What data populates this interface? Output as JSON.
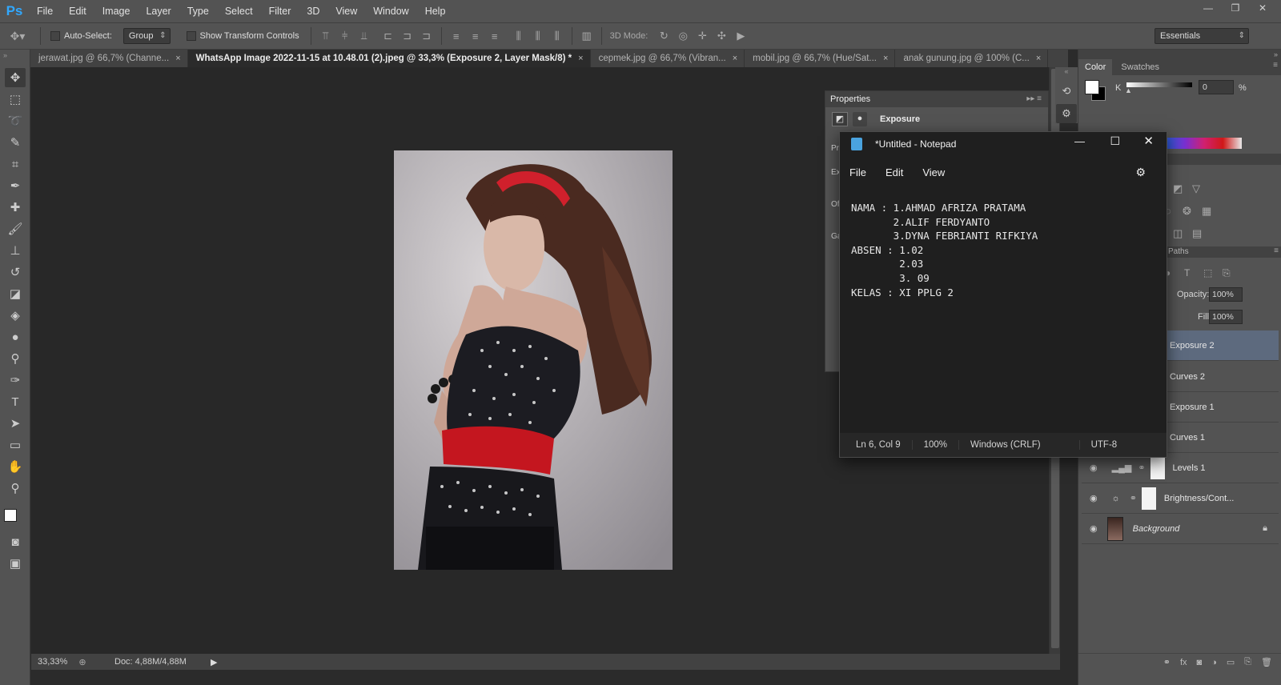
{
  "app": {
    "logo": "Ps"
  },
  "menu": [
    "File",
    "Edit",
    "Image",
    "Layer",
    "Type",
    "Select",
    "Filter",
    "3D",
    "View",
    "Window",
    "Help"
  ],
  "window_controls": [
    "—",
    "❐",
    "✕"
  ],
  "options": {
    "autoselect_label": "Auto-Select:",
    "group_value": "Group",
    "transform_label": "Show Transform Controls",
    "mode3d_label": "3D Mode:",
    "workspace": "Essentials"
  },
  "tabs": [
    {
      "label": "jerawat.jpg @ 66,7% (Channe...",
      "close": "×"
    },
    {
      "label": "WhatsApp Image 2022-11-15 at 10.48.01 (2).jpeg @ 33,3% (Exposure 2, Layer Mask/8) *",
      "close": "×"
    },
    {
      "label": "cepmek.jpg @ 66,7% (Vibran...",
      "close": "×"
    },
    {
      "label": "mobil.jpg @ 66,7% (Hue/Sat...",
      "close": "×"
    },
    {
      "label": "anak gunung.jpg @ 100% (C...",
      "close": "×"
    }
  ],
  "status": {
    "zoom": "33,33%",
    "doc": "Doc: 4,88M/4,88M"
  },
  "color_panel": {
    "tabs": [
      "Color",
      "Swatches"
    ],
    "channel": "K",
    "value": "0",
    "unit": "%"
  },
  "properties": {
    "title": "Properties",
    "adjustment": "Exposure",
    "partial_labels": [
      "Pr",
      "Ex",
      "Of",
      "Ga"
    ]
  },
  "layers_panel": {
    "tab": "Paths",
    "opacity_label": "Opacity:",
    "opacity": "100%",
    "fill_label": "Fill:",
    "fill": "100%",
    "layers": [
      {
        "name": "Exposure 2",
        "selected": true
      },
      {
        "name": "Curves 2"
      },
      {
        "name": "Exposure 1"
      },
      {
        "name": "Curves 1"
      },
      {
        "name": "Levels 1"
      },
      {
        "name": "Brightness/Cont..."
      },
      {
        "name": "Background"
      }
    ]
  },
  "notepad": {
    "title": "*Untitled - Notepad",
    "menu": [
      "File",
      "Edit",
      "View"
    ],
    "lines": [
      "NAMA : 1.AHMAD AFRIZA PRATAMA",
      "       2.ALIF FERDYANTO",
      "       3.DYNA FEBRIANTI RIFKIYA",
      "ABSEN : 1.02",
      "        2.03",
      "        3. 09",
      "KELAS : XI PPLG 2"
    ],
    "status": {
      "position": "Ln 6, Col 9",
      "zoom": "100%",
      "eol": "Windows (CRLF)",
      "encoding": "UTF-8"
    }
  }
}
